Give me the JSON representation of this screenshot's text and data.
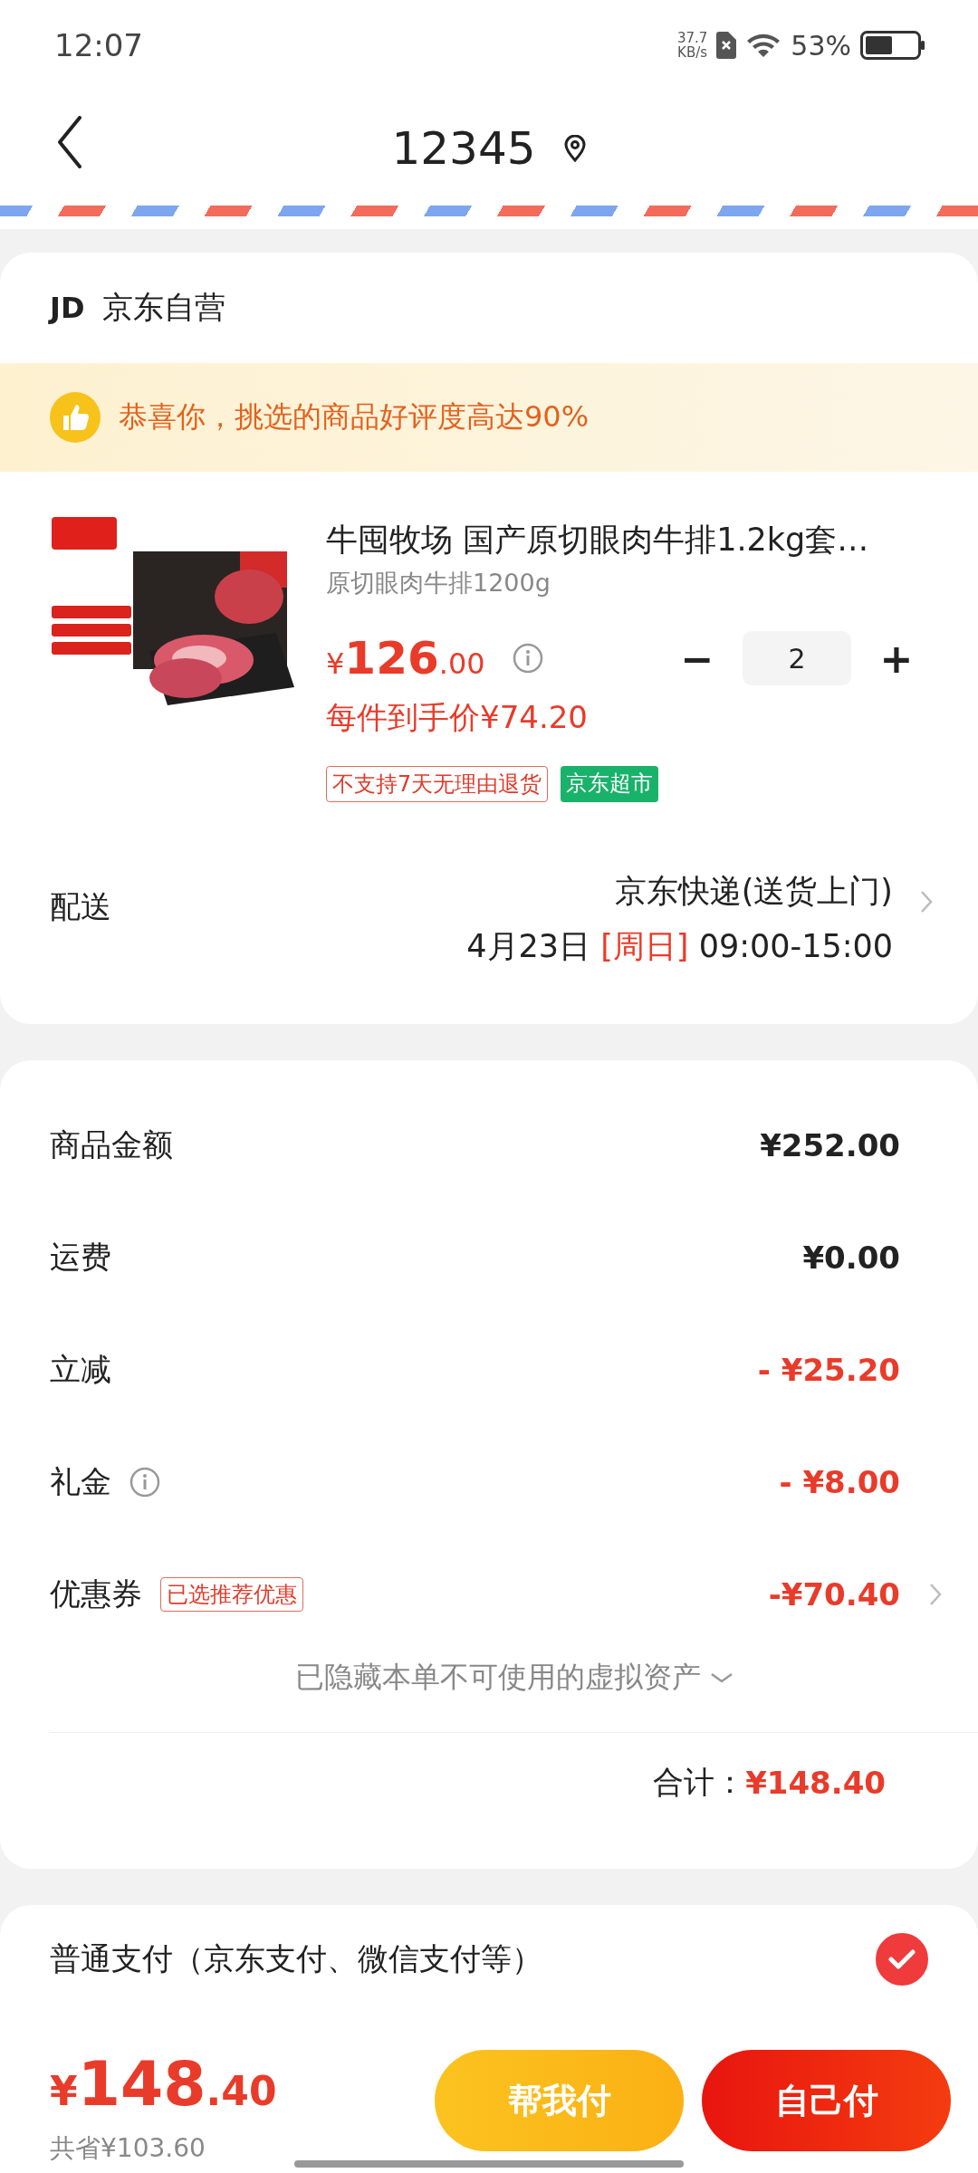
{
  "status_bar": {
    "time": "12:07",
    "net_speed_value": "37.7",
    "net_speed_unit": "KB/s",
    "battery": "53%"
  },
  "header": {
    "title": "12345"
  },
  "shop": {
    "badge": "JD",
    "name": "京东自营"
  },
  "banner": {
    "text": "恭喜你，挑选的商品好评度高达90%"
  },
  "product": {
    "title": "牛囤牧场 国产原切眼肉牛排1.2kg套…",
    "spec": "原切眼肉牛排1200g",
    "price_symbol": "¥",
    "price_int": "126",
    "price_dec": ".00",
    "unit_price": "每件到手价¥74.20",
    "minus": "−",
    "quantity": "2",
    "plus": "+",
    "tags": [
      {
        "text": "不支持7天无理由退货",
        "kind": "outline"
      },
      {
        "text": "京东超市",
        "kind": "filled"
      }
    ]
  },
  "delivery": {
    "label": "配送",
    "method": "京东快递(送货上门)",
    "date": "4月23日",
    "weekday": "[周日]",
    "time": "09:00-15:00"
  },
  "summary": {
    "rows": [
      {
        "label": "商品金额",
        "value": "¥252.00",
        "kind": "plain",
        "info": false,
        "chevron": false
      },
      {
        "label": "运费",
        "value": "¥0.00",
        "kind": "plain",
        "info": false,
        "chevron": false
      },
      {
        "label": "立减",
        "value": "- ¥25.20",
        "kind": "discount",
        "info": false,
        "chevron": false
      },
      {
        "label": "礼金",
        "value": "- ¥8.00",
        "kind": "discount",
        "info": true,
        "chevron": false
      },
      {
        "label": "优惠券",
        "tag": "已选推荐优惠",
        "value": "-¥70.40",
        "kind": "discount",
        "info": false,
        "chevron": true
      }
    ],
    "hidden_note": "已隐藏本单不可使用的虚拟资产",
    "total_label": "合计：",
    "total": "¥148.40"
  },
  "payment": {
    "options": [
      {
        "label": "普通支付（京东支付、微信支付等）",
        "selected": true
      }
    ]
  },
  "footer": {
    "price_symbol": "¥",
    "price_int": "148",
    "price_dec": ".40",
    "saved": "共省¥103.60",
    "buttons": [
      {
        "label": "帮我付",
        "kind": "secondary"
      },
      {
        "label": "自己付",
        "kind": "primary"
      }
    ]
  }
}
